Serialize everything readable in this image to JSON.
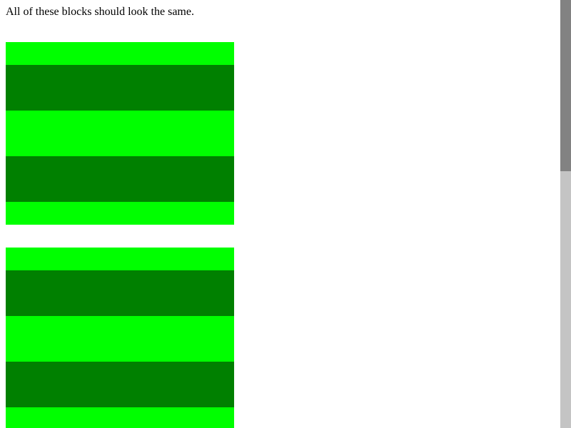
{
  "page": {
    "intro_text": "All of these blocks should look the same."
  },
  "colors": {
    "light_green": "#00ff00",
    "dark_green": "#008000",
    "background": "#ffffff",
    "scrollbar_track": "#c4c4c4",
    "scrollbar_thumb": "#828282"
  },
  "blocks": [
    {
      "stripes": [
        "light",
        "dark",
        "light",
        "dark",
        "light"
      ]
    },
    {
      "stripes": [
        "light",
        "dark",
        "light",
        "dark",
        "light"
      ]
    }
  ]
}
